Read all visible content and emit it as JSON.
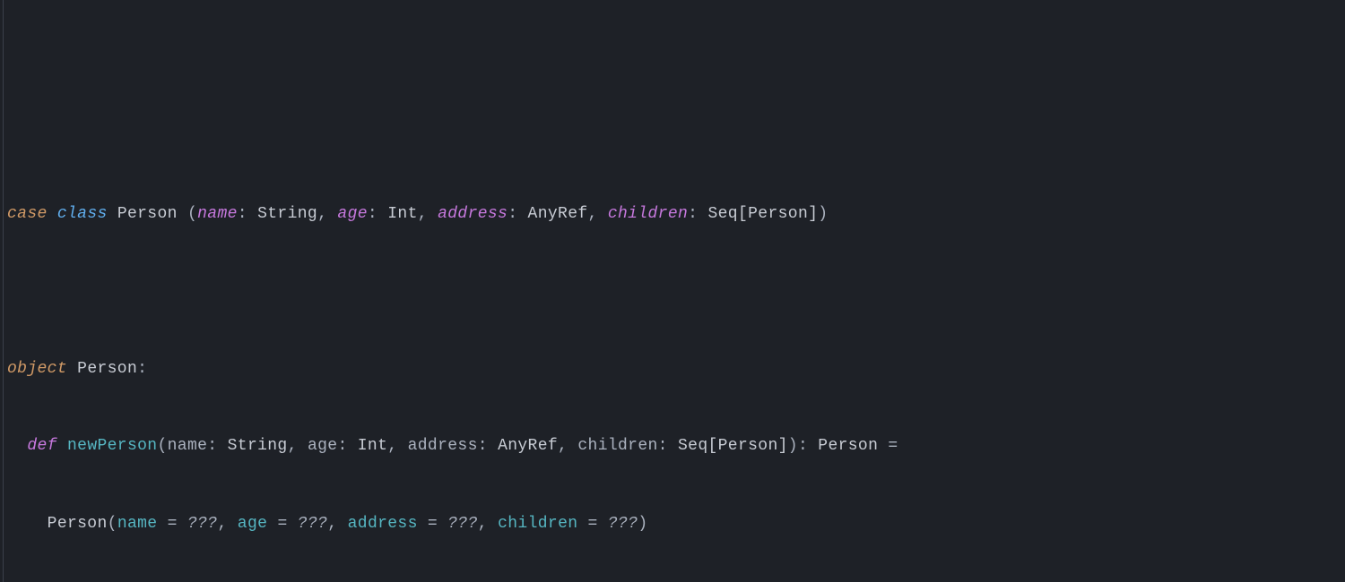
{
  "colors": {
    "background": "#1e2127",
    "foreground": "#abb2bf",
    "keyword_orange": "#d19a66",
    "keyword_blue": "#61afef",
    "keyword_purple": "#c678dd",
    "type_gray": "#c8ccd4",
    "param_magenta": "#c678dd",
    "funcname_cyan": "#56b6c2",
    "indent_guide": "#3a3f4b"
  },
  "code": {
    "line1": {
      "kw_case": "case",
      "kw_class": "class",
      "classname": "Person",
      "lparen": " (",
      "p1_name": "name",
      "p1_sep": ": ",
      "p1_type": "String",
      "c1": ", ",
      "p2_name": "age",
      "p2_sep": ": ",
      "p2_type": "Int",
      "c2": ", ",
      "p3_name": "address",
      "p3_sep": ": ",
      "p3_type": "AnyRef",
      "c3": ", ",
      "p4_name": "children",
      "p4_sep": ": ",
      "p4_type": "Seq[Person]",
      "rparen": ")"
    },
    "line3": {
      "kw_object": "object",
      "objname": "Person",
      "colon": ":"
    },
    "line4": {
      "indent": "  ",
      "kw_def": "def",
      "funcname": "newPerson",
      "lparen": "(",
      "p1_name": "name",
      "p1_sep": ": ",
      "p1_type": "String",
      "c1": ", ",
      "p2_name": "age",
      "p2_sep": ": ",
      "p2_type": "Int",
      "c2": ", ",
      "p3_name": "address",
      "p3_sep": ": ",
      "p3_type": "AnyRef",
      "c3": ", ",
      "p4_name": "children",
      "p4_sep": ": ",
      "p4_type": "Seq[Person]",
      "rparen": ")",
      "ret_sep": ": ",
      "rettype": "Person",
      "eq": " ="
    },
    "line5": {
      "indent": "    ",
      "calltype": "Person",
      "lparen": "(",
      "a1_name": "name",
      "a1_eq": " = ",
      "a1_val": "???",
      "c1": ", ",
      "a2_name": "age",
      "a2_eq": " = ",
      "a2_val": "???",
      "c2": ", ",
      "a3_name": "address",
      "a3_eq": " = ",
      "a3_val": "???",
      "c3": ", ",
      "a4_name": "children",
      "a4_eq": " = ",
      "a4_val": "???",
      "rparen": ")"
    }
  }
}
